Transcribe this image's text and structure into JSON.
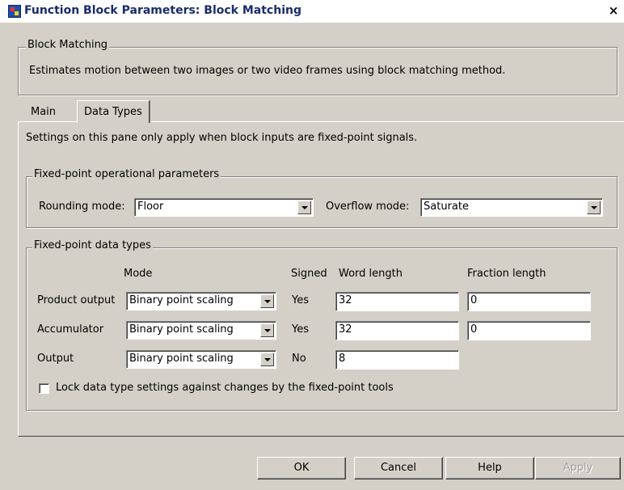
{
  "window": {
    "title": "Function Block Parameters: Block Matching",
    "close_glyph": "×"
  },
  "description_group": {
    "legend": "Block Matching",
    "text": "Estimates motion between two images or two video frames using block matching method."
  },
  "tabs": [
    {
      "label": "Main",
      "active": false
    },
    {
      "label": "Data Types",
      "active": true
    }
  ],
  "pane_note": "Settings on this pane only apply when block inputs are fixed-point signals.",
  "operational": {
    "legend": "Fixed-point operational parameters",
    "rounding_label": "Rounding mode:",
    "rounding_value": "Floor",
    "overflow_label": "Overflow mode:",
    "overflow_value": "Saturate"
  },
  "datatypes": {
    "legend": "Fixed-point data types",
    "headers": {
      "mode": "Mode",
      "signed": "Signed",
      "word": "Word length",
      "fraction": "Fraction length"
    },
    "rows": [
      {
        "label": "Product output",
        "mode": "Binary point scaling",
        "signed": "Yes",
        "word": "32",
        "fraction": "0"
      },
      {
        "label": "Accumulator",
        "mode": "Binary point scaling",
        "signed": "Yes",
        "word": "32",
        "fraction": "0"
      },
      {
        "label": "Output",
        "mode": "Binary point scaling",
        "signed": "No",
        "word": "8"
      }
    ],
    "lock_label": "Lock data type settings against changes by the fixed-point tools",
    "lock_checked": false
  },
  "buttons": {
    "ok": "OK",
    "cancel": "Cancel",
    "help": "Help",
    "apply": "Apply"
  }
}
